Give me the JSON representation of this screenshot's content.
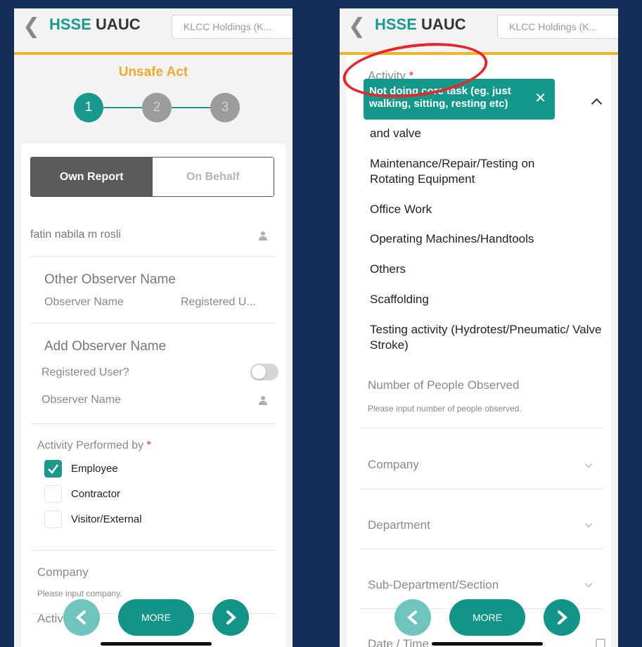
{
  "header": {
    "brand_highlight": "HSSE",
    "brand_rest": "UAUC",
    "org": "KLCC Holdings (K..."
  },
  "left": {
    "page_title": "Unsafe Act",
    "steps": [
      "1",
      "2",
      "3"
    ],
    "active_step": 1,
    "tabs": {
      "own": "Own Report",
      "behalf": "On Behalf"
    },
    "reporter_name": "fatin nabila m rosli",
    "other_observer": {
      "title": "Other Observer Name",
      "col1": "Observer Name",
      "col2": "Registered U..."
    },
    "add_observer": {
      "title": "Add Observer Name",
      "registered_label": "Registered User?",
      "registered_on": false,
      "name_placeholder": "Observer Name"
    },
    "activity_performed": {
      "label": "Activity Performed by",
      "required_mark": "*",
      "options": [
        {
          "label": "Employee",
          "checked": true
        },
        {
          "label": "Contractor",
          "checked": false
        },
        {
          "label": "Visitor/External",
          "checked": false
        }
      ]
    },
    "company": {
      "label": "Company",
      "placeholder": "Please input company."
    },
    "activity_label": "Activity",
    "activity_required": "*"
  },
  "right": {
    "activity_label": "Activity",
    "activity_required": "*",
    "selected_chip": "Not doing core task (eg. just walking, sitting, resting etc)",
    "clipped_item": "and valve",
    "options": [
      "Maintenance/Repair/Testing on Rotating Equipment",
      "Office Work",
      "Operating Machines/Handtools",
      "Others",
      "Scaffolding",
      "Testing activity (Hydrotest/Pneumatic/ Valve Stroke)"
    ],
    "people_observed": {
      "label": "Number of People Observed",
      "placeholder": "Please input number of people observed."
    },
    "company_label": "Company",
    "department_label": "Department",
    "subdepartment_label": "Sub-Department/Section",
    "date_label": "Date / Time"
  },
  "nav": {
    "more": "MORE"
  },
  "colors": {
    "teal": "#1a9a8f",
    "accent": "#f0b329",
    "title": "#f0a92d",
    "required": "#e0253a",
    "annotation": "#e62629",
    "background": "#14305a"
  }
}
